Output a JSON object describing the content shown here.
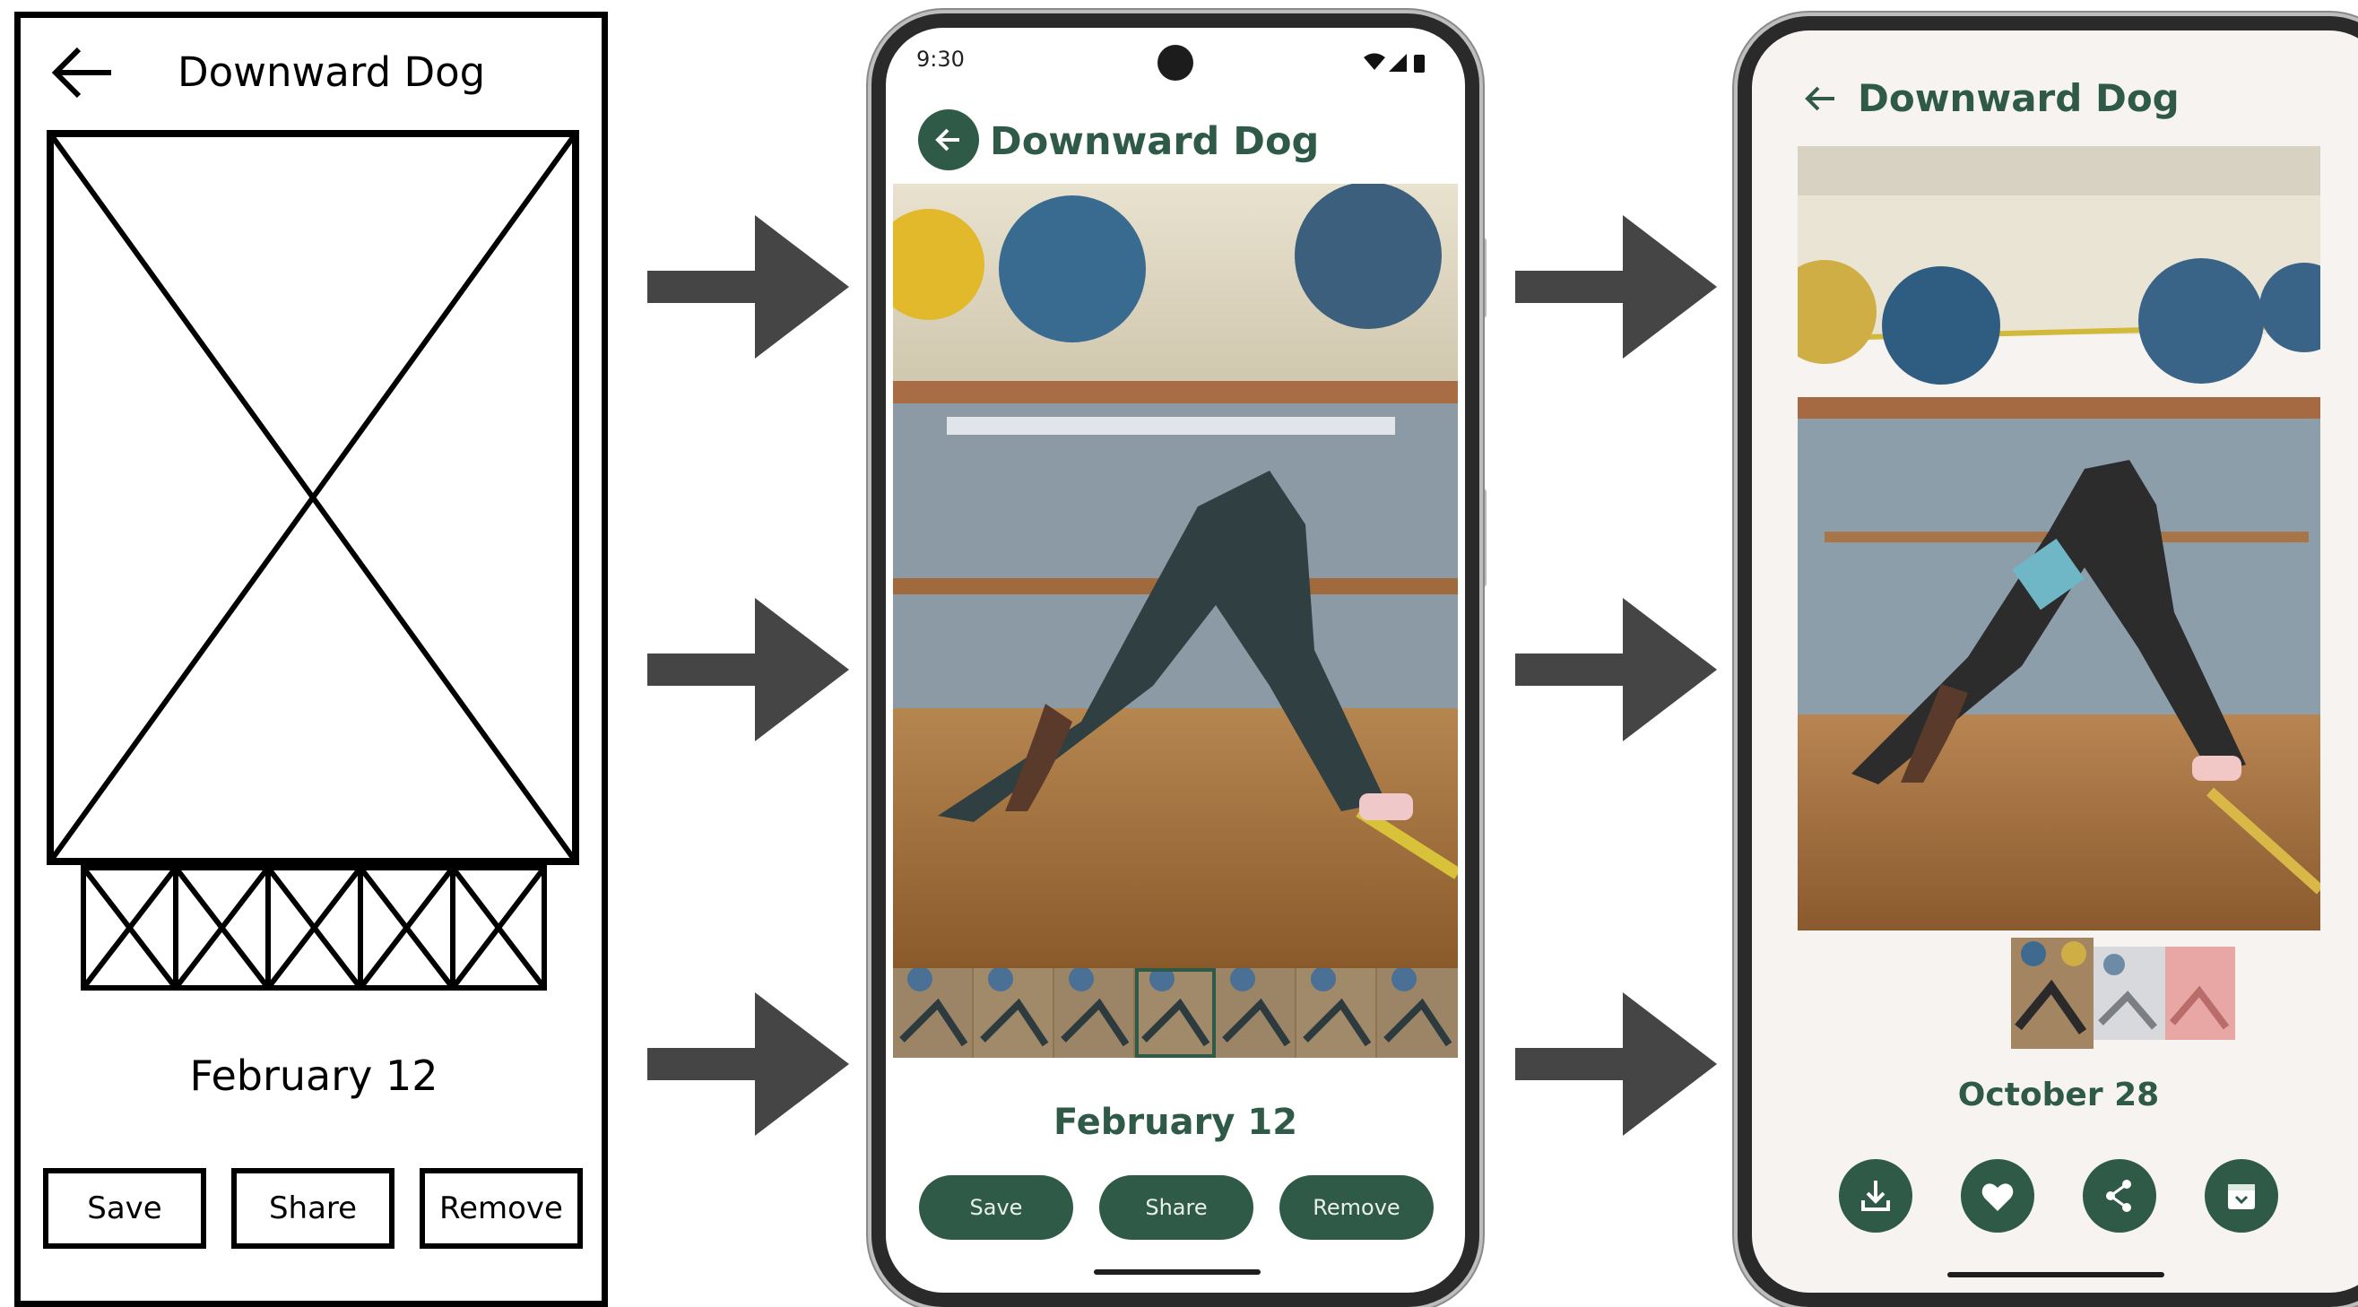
{
  "wireframe": {
    "title": "Downward Dog",
    "date": "February 12",
    "buttons": {
      "save": "Save",
      "share": "Share",
      "remove": "Remove"
    }
  },
  "phone_mockup": {
    "status_time": "9:30",
    "title": "Downward Dog",
    "date": "February 12",
    "buttons": {
      "save": "Save",
      "share": "Share",
      "remove": "Remove"
    }
  },
  "phone_final": {
    "title": "Downward Dog",
    "date": "October 28",
    "action_icons": [
      "download-icon",
      "heart-icon",
      "share-icon",
      "archive-icon"
    ]
  },
  "colors": {
    "brand_green": "#2f5a47",
    "arrow": "#454545",
    "final_background": "#f7f3f1"
  }
}
